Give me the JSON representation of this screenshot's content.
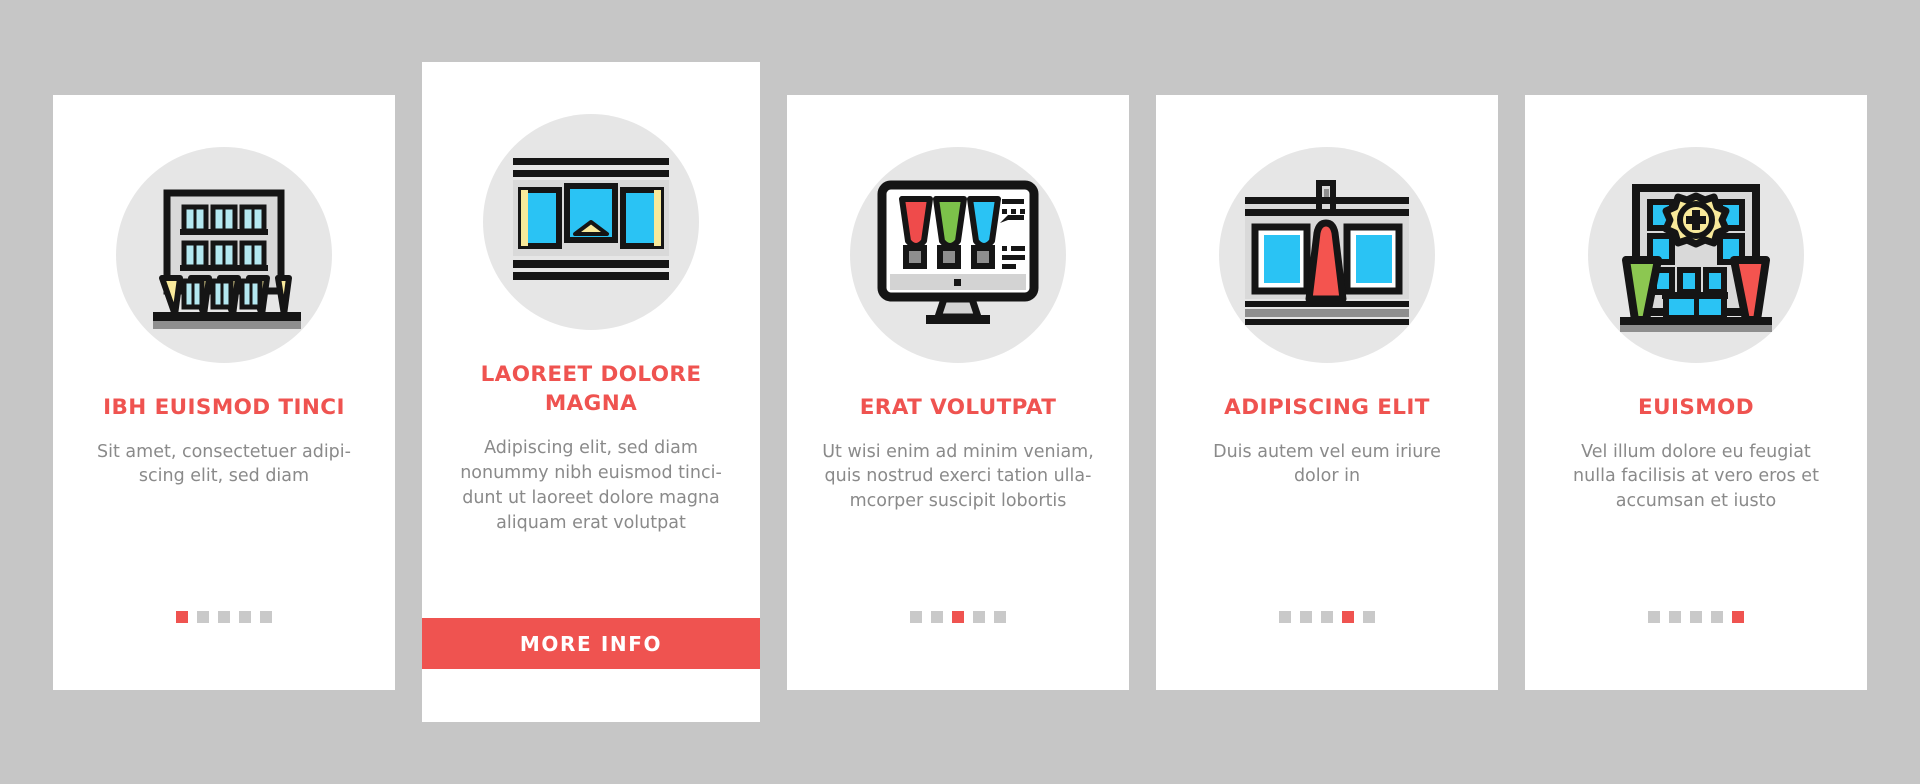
{
  "page": {
    "background_color": "#c6c6c6",
    "card_background": "#ffffff",
    "accent_color": "#ef5350",
    "title_color": "#ef5350",
    "body_text_color": "#8a8a8a",
    "icon_circle_color": "#e6e6e6",
    "dot_inactive_color": "#c9c9c9"
  },
  "cards": [
    {
      "icon_name": "apartment-building-icon",
      "title": "IBH EUISMOD TINCI",
      "description": "Sit amet, consectetuer adipi-scing elit, sed diam",
      "dots": {
        "count": 5,
        "active_index": 0
      },
      "featured": false
    },
    {
      "icon_name": "storefront-window-icon",
      "title": "LAOREET DOLORE MAGNA",
      "description": "Adipiscing elit, sed diam nonummy nibh euismod tincidunt ut laoreet dolore magna aliquam erat volutpat",
      "button_label": "MORE INFO",
      "featured": true
    },
    {
      "icon_name": "desktop-monitor-lab-icon",
      "title": "ERAT VOLUTPAT",
      "description": "Ut wisi enim ad minim veniam, quis nostrud exerci tation ulla-mcorper suscipit lobortis",
      "dots": {
        "count": 5,
        "active_index": 2
      },
      "featured": false
    },
    {
      "icon_name": "shop-awning-icon",
      "title": "ADIPISCING ELIT",
      "description": "Duis autem vel eum iriure dolor in",
      "dots": {
        "count": 5,
        "active_index": 3
      },
      "featured": false
    },
    {
      "icon_name": "hospital-gear-icon",
      "title": "EUISMOD",
      "description": "Vel illum dolore eu feugiat nulla facilisis at vero eros et accumsan et iusto",
      "dots": {
        "count": 5,
        "active_index": 4
      },
      "featured": false
    }
  ],
  "icon_colors": {
    "outline": "#151515",
    "wall": "#d9d9d9",
    "window_cyan": "#2ac3f4",
    "window_light_cyan": "#b4e8f0",
    "awning_yellow": "#f8e99a",
    "awning_red": "#f4544f",
    "awning_green": "#8cc751",
    "ground_gray": "#8e8e8e",
    "gear_yellow": "#f8e99a",
    "tube_red": "#ef4b4b",
    "tube_green": "#7cc24a",
    "tube_blue": "#2ac3f4",
    "screen_base": "#d3d3d3"
  }
}
